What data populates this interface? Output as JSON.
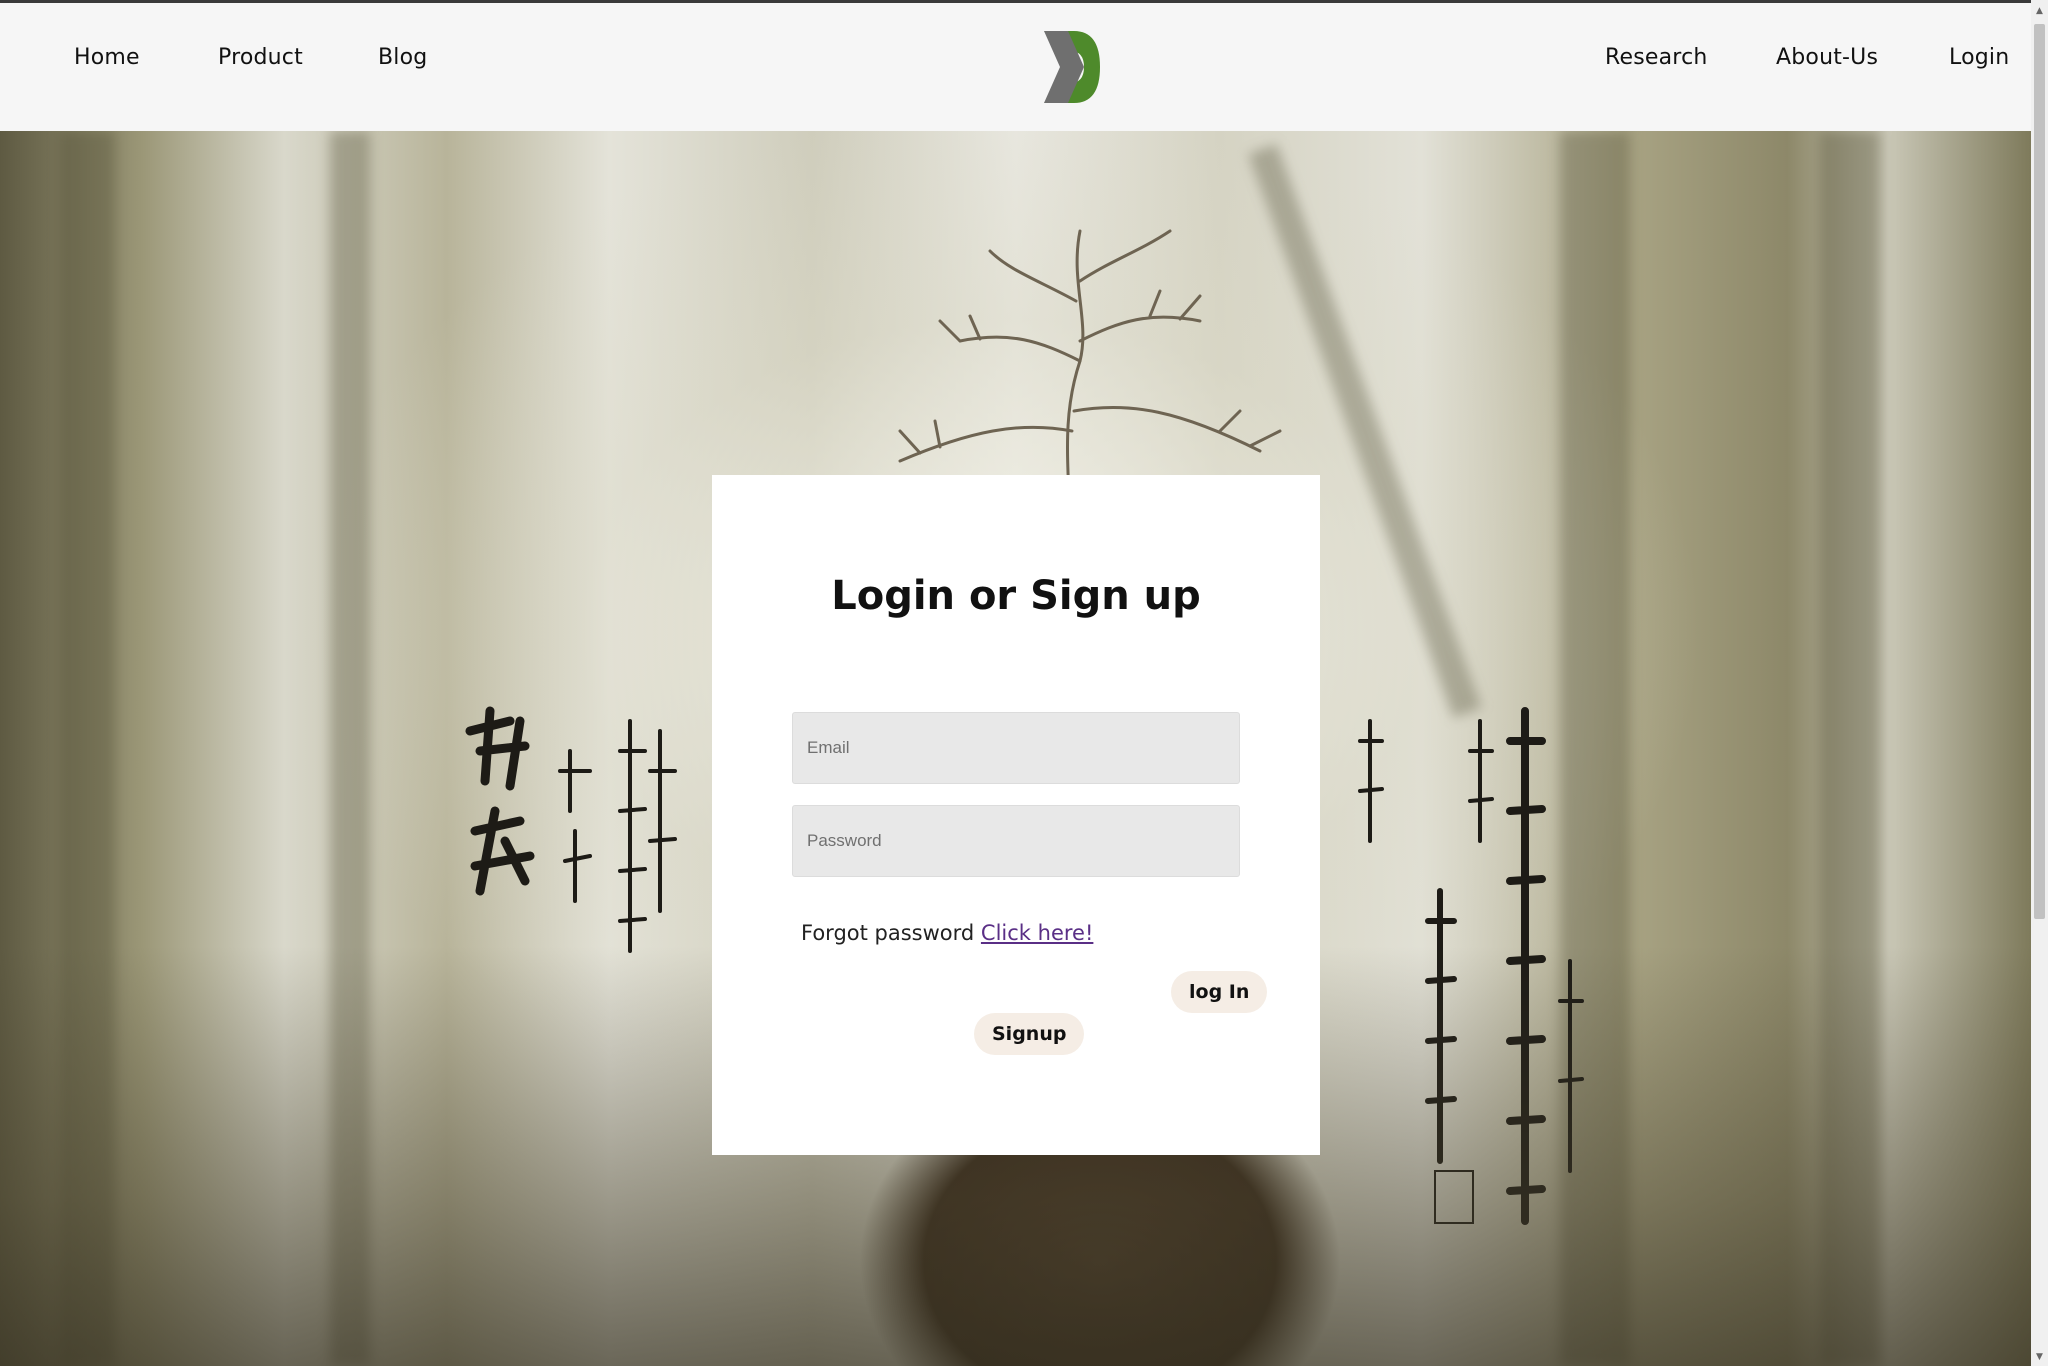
{
  "nav": {
    "left": [
      "Home",
      "Product",
      "Blog"
    ],
    "right": [
      "Research",
      "About-Us",
      "Login"
    ]
  },
  "logo": {
    "icon": "sigma-logo-icon",
    "colors": {
      "gray": "#6f6f6f",
      "green": "#4e8a2b"
    }
  },
  "login": {
    "title": "Login or Sign up",
    "email_placeholder": "Email",
    "password_placeholder": "Password",
    "forgot_text": "Forgot password",
    "forgot_link": "Click here!",
    "login_button": "log In",
    "signup_button": "Signup"
  },
  "colors": {
    "link": "#5a2f86",
    "pill_bg": "#f5ede5",
    "card_bg": "#ffffff",
    "field_bg": "#e8e8e8"
  }
}
